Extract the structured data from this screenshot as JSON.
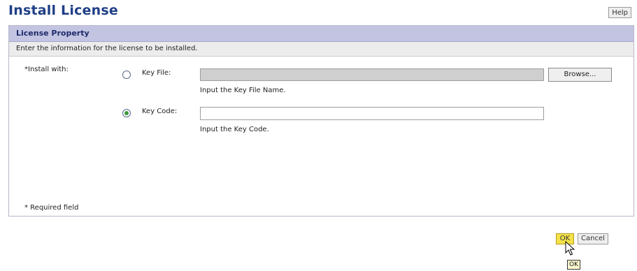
{
  "header": {
    "title": "Install License",
    "help_label": "Help"
  },
  "panel": {
    "title": "License Property",
    "description": "Enter the information for the license to be installed."
  },
  "form": {
    "install_with_label": "*Install with:",
    "key_file": {
      "label": "Key File:",
      "value": "",
      "hint": "Input the Key File Name.",
      "browse_label": "Browse...",
      "selected": false
    },
    "key_code": {
      "label": "Key Code:",
      "value": "",
      "hint": "Input the Key Code.",
      "selected": true
    },
    "required_note": "* Required field"
  },
  "footer": {
    "ok_label": "OK",
    "cancel_label": "Cancel",
    "tooltip": "OK"
  },
  "colors": {
    "title": "#1f3f86",
    "panel_header_bg": "#c2c4e2",
    "ok_button_bg": "#f5e24a",
    "radio_selected": "#3a9a3a"
  },
  "icons": {
    "cursor": "mouse-pointer-icon"
  }
}
